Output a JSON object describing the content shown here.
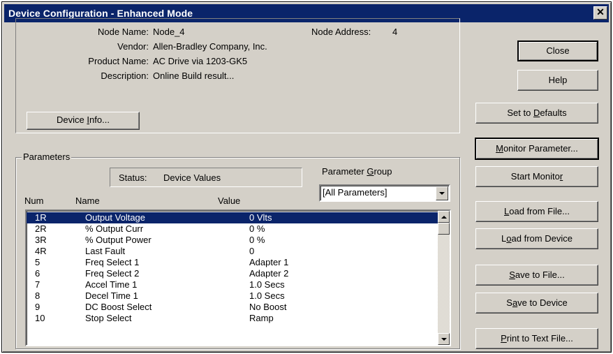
{
  "window": {
    "title": "Device Configuration - Enhanced Mode",
    "close_glyph": "✕"
  },
  "device_info": {
    "node_name_label": "Node Name:",
    "node_name": "Node_4",
    "vendor_label": "Vendor:",
    "vendor": "Allen-Bradley Company, Inc.",
    "product_label": "Product Name:",
    "product": "AC Drive via 1203-GK5",
    "description_label": "Description:",
    "description": "Online Build result...",
    "node_address_label": "Node Address:",
    "node_address": "4",
    "device_info_button": {
      "pre": "Device ",
      "key": "I",
      "post": "nfo..."
    }
  },
  "parameters": {
    "group_title": "Parameters",
    "status_label": "Status:",
    "status_value": "Device Values",
    "param_group_label": {
      "pre": "Parameter ",
      "key": "G",
      "post": "roup"
    },
    "param_group_selected": "[All Parameters]",
    "columns": {
      "num": "Num",
      "name": "Name",
      "value": "Value"
    },
    "rows": [
      {
        "num": "1R",
        "name": "Output Voltage",
        "value": "0 Vlts"
      },
      {
        "num": "2R",
        "name": "% Output Curr",
        "value": "0 %"
      },
      {
        "num": "3R",
        "name": "% Output Power",
        "value": "0 %"
      },
      {
        "num": "4R",
        "name": "Last Fault",
        "value": "0"
      },
      {
        "num": "5",
        "name": "Freq Select 1",
        "value": "Adapter 1"
      },
      {
        "num": "6",
        "name": "Freq Select 2",
        "value": "Adapter 2"
      },
      {
        "num": "7",
        "name": "Accel Time 1",
        "value": "1.0 Secs"
      },
      {
        "num": "8",
        "name": "Decel Time 1",
        "value": "1.0 Secs"
      },
      {
        "num": "9",
        "name": "DC Boost Select",
        "value": "No Boost"
      },
      {
        "num": "10",
        "name": "Stop Select",
        "value": "Ramp"
      }
    ]
  },
  "buttons": {
    "close": {
      "pre": "Close",
      "key": "",
      "post": ""
    },
    "help": {
      "pre": "Help",
      "key": "",
      "post": ""
    },
    "set_defaults": {
      "pre": "Set to ",
      "key": "D",
      "post": "efaults"
    },
    "monitor_param": {
      "pre": "",
      "key": "M",
      "post": "onitor Parameter..."
    },
    "start_monitor": {
      "pre": "Start Monito",
      "key": "r",
      "post": ""
    },
    "load_file": {
      "pre": "",
      "key": "L",
      "post": "oad from File..."
    },
    "load_device": {
      "pre": "L",
      "key": "o",
      "post": "ad from Device"
    },
    "save_file": {
      "pre": "",
      "key": "S",
      "post": "ave to File..."
    },
    "save_device": {
      "pre": "S",
      "key": "a",
      "post": "ve to Device"
    },
    "print_file": {
      "pre": "",
      "key": "P",
      "post": "rint to Text File..."
    }
  }
}
